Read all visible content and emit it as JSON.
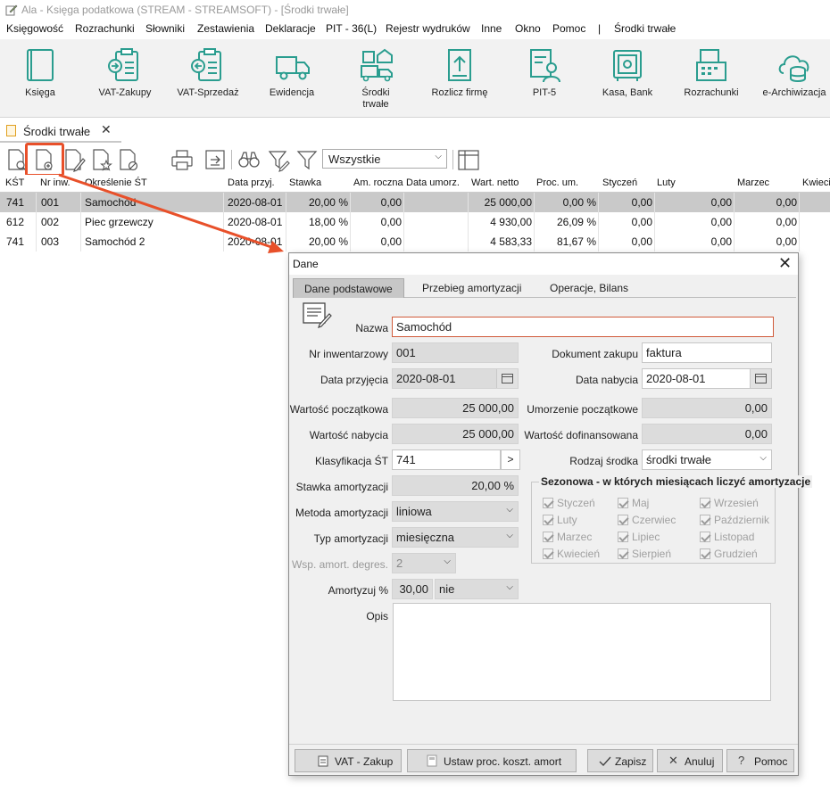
{
  "window": {
    "title": "Ala - Księga podatkowa (STREAM - STREAMSOFT) - [Środki trwałe]"
  },
  "menu": [
    "Księgowość",
    "Rozrachunki",
    "Słowniki",
    "Zestawienia",
    "Deklaracje",
    "PIT - 36(L)",
    "Rejestr wydruków",
    "Inne",
    "Okno",
    "Pomoc",
    "|",
    "Środki trwałe"
  ],
  "ribbon": [
    {
      "label": "Księga",
      "icon": "book-icon"
    },
    {
      "label": "VAT-Zakupy",
      "icon": "clipboard-in-icon"
    },
    {
      "label": "VAT-Sprzedaż",
      "icon": "clipboard-out-icon"
    },
    {
      "label": "Ewidencja",
      "icon": "truck-icon"
    },
    {
      "label": "Środki trwałe",
      "icon": "assets-icon"
    },
    {
      "label": "Rozlicz firmę",
      "icon": "document-upload-icon"
    },
    {
      "label": "PIT-5",
      "icon": "person-document-icon"
    },
    {
      "label": "Kasa, Bank",
      "icon": "safe-icon"
    },
    {
      "label": "Rozrachunki",
      "icon": "cash-register-icon"
    },
    {
      "label": "e-Archiwizacja",
      "icon": "cloud-database-icon"
    }
  ],
  "doc_tab": {
    "label": "Środki trwałe"
  },
  "toolbar": {
    "filter": "Wszystkie"
  },
  "grid": {
    "columns": [
      "KŚT",
      "Nr inw.",
      "Określenie ŚT",
      "Data przyj.",
      "Stawka",
      "Am. roczna",
      "Data umorz.",
      "Wart. netto",
      "Proc. um.",
      "Styczeń",
      "Luty",
      "Marzec",
      "Kwieci"
    ],
    "rows": [
      [
        "741",
        "001",
        "Samochód",
        "2020-08-01",
        "20,00 %",
        "0,00",
        "",
        "25 000,00",
        "0,00 %",
        "0,00",
        "0,00",
        "0,00"
      ],
      [
        "612",
        "002",
        "Piec grzewczy",
        "2020-08-01",
        "18,00 %",
        "0,00",
        "",
        "4 930,00",
        "26,09 %",
        "0,00",
        "0,00",
        "0,00"
      ],
      [
        "741",
        "003",
        "Samochód 2",
        "2020-08-01",
        "20,00 %",
        "0,00",
        "",
        "4 583,33",
        "81,67 %",
        "0,00",
        "0,00",
        "0,00"
      ]
    ]
  },
  "dialog": {
    "title": "Dane",
    "tabs": [
      "Dane podstawowe",
      "Przebieg amortyzacji",
      "Operacje, Bilans"
    ],
    "labels": {
      "nazwa": "Nazwa",
      "nr_inw": "Nr inwentarzowy",
      "dokument": "Dokument zakupu",
      "data_przyjecia": "Data przyjęcia",
      "data_nabycia": "Data nabycia",
      "wart_pocz": "Wartość początkowa",
      "umorz_pocz": "Umorzenie początkowe",
      "wart_nabycia": "Wartość nabycia",
      "wart_dofin": "Wartość dofinansowana",
      "klasyfikacja": "Klasyfikacja ŚT",
      "rodzaj": "Rodzaj środka",
      "stawka": "Stawka amortyzacji",
      "metoda": "Metoda amortyzacji",
      "typ": "Typ amortyzacji",
      "wsp": "Wsp. amort. degres.",
      "amortyzuj": "Amortyzuj %",
      "opis": "Opis"
    },
    "values": {
      "nazwa": "Samochód",
      "nr_inw": "001",
      "dokument": "faktura",
      "data_przyjecia": "2020-08-01",
      "data_nabycia": "2020-08-01",
      "wart_pocz": "25 000,00",
      "umorz_pocz": "0,00",
      "wart_nabycia": "25 000,00",
      "wart_dofin": "0,00",
      "klasyfikacja": "741",
      "rodzaj": "środki trwałe",
      "stawka": "20,00 %",
      "metoda": "liniowa",
      "typ": "miesięczna",
      "wsp": "2",
      "amortyzuj_pct": "30,00",
      "amortyzuj_opt": "nie",
      "opis": ""
    },
    "seasonal": {
      "title": "Sezonowa - w których miesiącach liczyć amortyzacje",
      "months": [
        "Styczeń",
        "Maj",
        "Wrzesień",
        "Luty",
        "Czerwiec",
        "Październik",
        "Marzec",
        "Lipiec",
        "Listopad",
        "Kwiecień",
        "Sierpień",
        "Grudzień"
      ]
    },
    "buttons": {
      "vat_zakup": "VAT - Zakup",
      "ustaw": "Ustaw proc. koszt. amort",
      "zapisz": "Zapisz",
      "anuluj": "Anuluj",
      "pomoc": "Pomoc"
    }
  },
  "colors": {
    "accent": "#2a9d8f",
    "highlight": "#e8502a"
  }
}
